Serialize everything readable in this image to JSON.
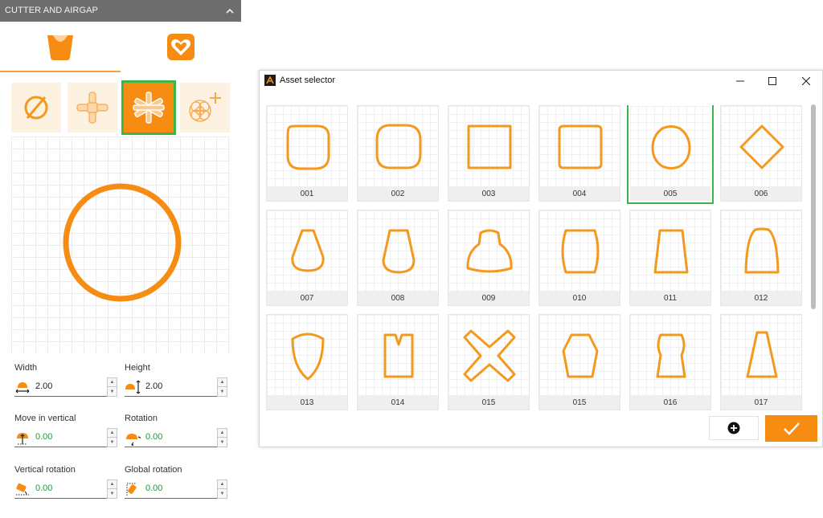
{
  "left_panel": {
    "header": {
      "title": "CUTTER AND AIRGAP"
    },
    "fields": {
      "width": {
        "label": "Width",
        "value": "2.00"
      },
      "height": {
        "label": "Height",
        "value": "2.00"
      },
      "move_vertical": {
        "label": "Move in vertical",
        "value": "0.00"
      },
      "rotation": {
        "label": "Rotation",
        "value": "0.00"
      },
      "vertical_rotation": {
        "label": "Vertical rotation",
        "value": "0.00"
      },
      "global_rotation": {
        "label": "Global rotation",
        "value": "0.00"
      }
    }
  },
  "asset_selector": {
    "title": "Asset selector",
    "assets": [
      {
        "label": "001",
        "shape": "squircle-tall"
      },
      {
        "label": "002",
        "shape": "squircle-wide"
      },
      {
        "label": "003",
        "shape": "square"
      },
      {
        "label": "004",
        "shape": "rounded-square"
      },
      {
        "label": "005",
        "shape": "rounded-diamond",
        "selected": true
      },
      {
        "label": "006",
        "shape": "diamond"
      },
      {
        "label": "007",
        "shape": "pear"
      },
      {
        "label": "008",
        "shape": "cone"
      },
      {
        "label": "009",
        "shape": "bell"
      },
      {
        "label": "010",
        "shape": "barrel"
      },
      {
        "label": "011",
        "shape": "trapezoid"
      },
      {
        "label": "012",
        "shape": "arch"
      },
      {
        "label": "013",
        "shape": "shield"
      },
      {
        "label": "014",
        "shape": "notched-tooth"
      },
      {
        "label": "015",
        "shape": "cross"
      },
      {
        "label": "015",
        "shape": "hexagon"
      },
      {
        "label": "016",
        "shape": "vase"
      },
      {
        "label": "017",
        "shape": "tall-trapezoid"
      }
    ]
  },
  "colors": {
    "accent": "#F68D12",
    "shape_stroke": "#F39A1E",
    "selection": "#3CB54A",
    "header_bg": "#6D6D6D"
  }
}
